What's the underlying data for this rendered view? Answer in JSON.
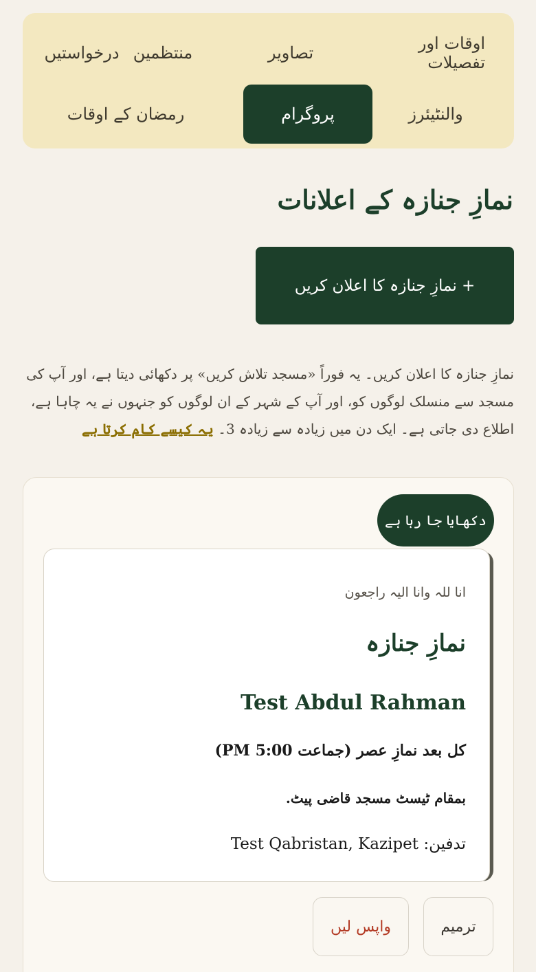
{
  "tabs": [
    {
      "label": "اوقات اور تفصیلات",
      "active": false
    },
    {
      "label": "تصاویر",
      "active": false
    },
    {
      "label": "منتظمین",
      "active": false
    },
    {
      "label": "درخواستیں",
      "active": false
    },
    {
      "label": "والنٹیئرز",
      "active": false
    },
    {
      "label": "پروگرام",
      "active": true
    },
    {
      "label": "رمضان کے اوقات",
      "active": false
    }
  ],
  "page_title": "نمازِ جنازہ کے اعلانات",
  "announce_button": "+ نمازِ جنازہ کا اعلان کریں",
  "description": {
    "text": "نمازِ جنازہ کا اعلان کریں۔ یہ فوراً «مسجد تلاش کریں» پر دکھائی دیتا ہے، اور آپ کی مسجد سے منسلک لوگوں کو، اور آپ کے شہر کے ان لوگوں کو جنہوں نے یہ چاہا ہے، اطلاع دی جاتی ہے۔ ایک دن میں زیادہ سے زیادہ 3۔",
    "link": "یہ کیسے کام کرتا ہے"
  },
  "announcement": {
    "status_badge": "دکھایا جا رہا ہے",
    "verse": "انا للہ وانا الیہ راجعون",
    "heading": "نمازِ جنازہ",
    "name": "Test Abdul Rahman",
    "timing": "کل بعد نمازِ عصر (جماعت 5:00 PM)",
    "location": "بمقام ٹیسٹ مسجد قاضی پیٹ.",
    "burial_label": "تدفین:",
    "burial_place": "Test Qabristan, Kazipet",
    "edit_button": "ترمیم",
    "withdraw_button": "واپس لیں"
  },
  "colors": {
    "primary": "#1c3f2a",
    "tab_panel": "#f3e8c0",
    "link": "#8a6d00",
    "danger": "#b33a24",
    "background": "#f5f1ea"
  }
}
